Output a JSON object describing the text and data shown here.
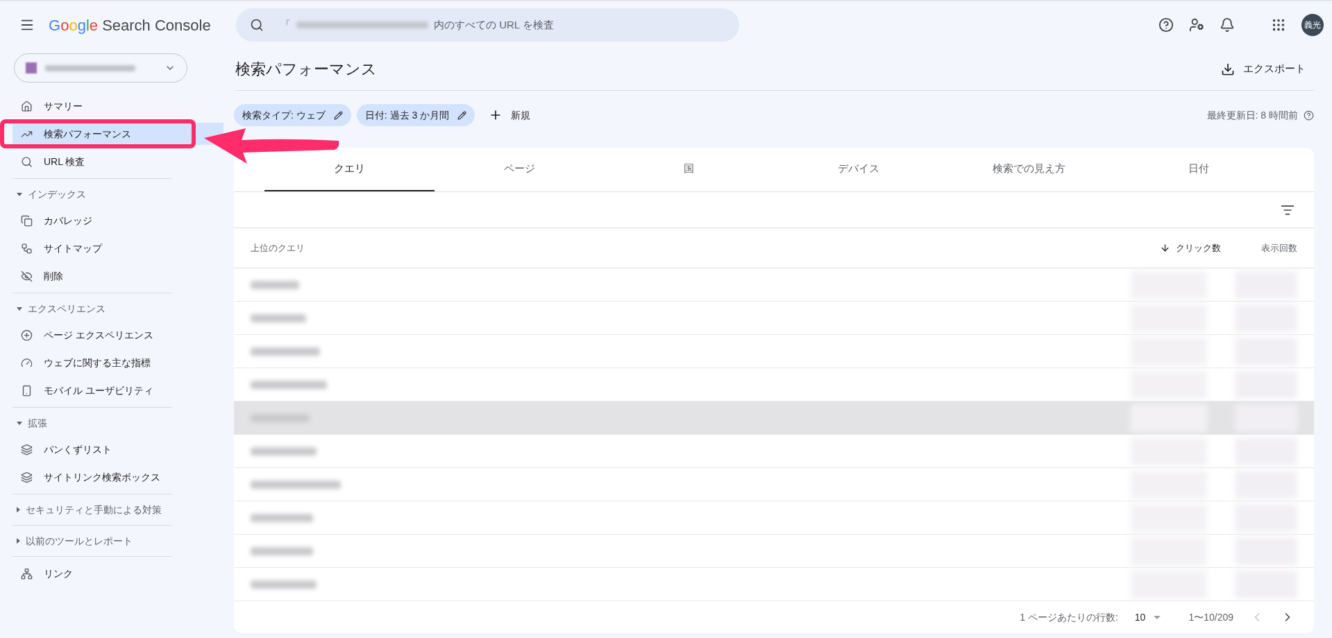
{
  "app": {
    "brand": "Google",
    "product": "Search Console"
  },
  "search": {
    "prefix": "「",
    "suffix": "内のすべての URL を検査"
  },
  "account": {
    "initials": "義光"
  },
  "sidebar": {
    "items": [
      {
        "kind": "item",
        "label": "サマリー",
        "selected": false
      },
      {
        "kind": "item",
        "label": "検索パフォーマンス",
        "selected": true
      },
      {
        "kind": "item",
        "label": "URL 検査",
        "selected": false
      },
      {
        "kind": "section",
        "label": "インデックス",
        "expanded": true,
        "children": [
          {
            "label": "カバレッジ",
            "selected": false
          },
          {
            "label": "サイトマップ",
            "selected": false
          },
          {
            "label": "削除",
            "selected": false
          }
        ]
      },
      {
        "kind": "section",
        "label": "エクスペリエンス",
        "expanded": true,
        "children": [
          {
            "label": "ページ エクスペリエンス",
            "selected": false
          },
          {
            "label": "ウェブに関する主な指標",
            "selected": false
          },
          {
            "label": "モバイル ユーザビリティ",
            "selected": false
          }
        ]
      },
      {
        "kind": "section",
        "label": "拡張",
        "expanded": true,
        "children": [
          {
            "label": "パンくずリスト",
            "selected": false
          },
          {
            "label": "サイトリンク検索ボックス",
            "selected": false
          }
        ]
      },
      {
        "kind": "section",
        "label": "セキュリティと手動による対策",
        "expanded": false
      },
      {
        "kind": "section",
        "label": "以前のツールとレポート",
        "expanded": false
      },
      {
        "kind": "item",
        "label": "リンク",
        "selected": false
      }
    ]
  },
  "page": {
    "title": "検索パフォーマンス",
    "export": "エクスポート",
    "last_updated": "最終更新日: 8 時間前"
  },
  "filters": [
    {
      "label": "検索タイプ: ウェブ"
    },
    {
      "label": "日付: 過去 3 か月間"
    }
  ],
  "new_filter": "新規",
  "tabs": [
    {
      "label": "クエリ",
      "selected": true
    },
    {
      "label": "ページ",
      "selected": false
    },
    {
      "label": "国",
      "selected": false
    },
    {
      "label": "デバイス",
      "selected": false
    },
    {
      "label": "検索での見え方",
      "selected": false
    },
    {
      "label": "日付",
      "selected": false
    }
  ],
  "table": {
    "columns": [
      {
        "label": "上位のクエリ",
        "sorted": false
      },
      {
        "label": "クリック数",
        "sorted": true
      },
      {
        "label": "表示回数",
        "sorted": false
      }
    ],
    "rows": [
      {
        "highlighted": false
      },
      {
        "highlighted": false
      },
      {
        "highlighted": false
      },
      {
        "highlighted": false
      },
      {
        "highlighted": true
      },
      {
        "highlighted": false
      },
      {
        "highlighted": false
      },
      {
        "highlighted": false
      },
      {
        "highlighted": false
      },
      {
        "highlighted": false
      }
    ]
  },
  "pagination": {
    "rows_per_page_label": "1 ページあたりの行数:",
    "rows_per_page": "10",
    "range": "1〜10/209",
    "prev_disabled": true,
    "next_disabled": false
  }
}
